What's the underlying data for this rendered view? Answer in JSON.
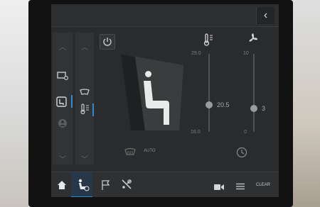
{
  "topbar": {
    "back_glyph": "‹"
  },
  "controls": {
    "power_icon": "power-icon",
    "seat_icon": "seat-icon",
    "temp_icon": "thermometer-icon",
    "fan_icon": "fan-icon"
  },
  "temperature": {
    "max_label": "29.0",
    "min_label": "16.0",
    "value_label": "20.5",
    "level": 0.33
  },
  "fan": {
    "max_label": "10",
    "min_label": "0",
    "value_label": "3",
    "level": 0.3
  },
  "bottom": {
    "auto_label": "AUTO",
    "clear_label": "CLEAR"
  },
  "accent_color": "#2b8bd9"
}
